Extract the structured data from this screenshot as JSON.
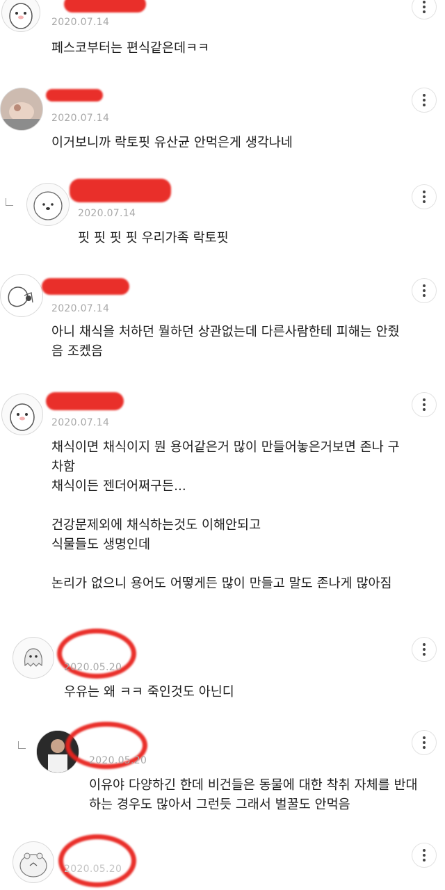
{
  "comments": [
    {
      "date": "2020.07.14",
      "text": "페스코부터는 편식같은데ㅋㅋ",
      "avatar": "penguin-avatar"
    },
    {
      "date": "2020.07.14",
      "text": "이거보니까 락토핏 유산균 안먹은게 생각나네",
      "avatar": "photo-avatar"
    },
    {
      "date": "2020.07.14",
      "text": "핏 핏 핏 핏 우리가족 락토핏",
      "avatar": "bear-avatar",
      "reply": true
    },
    {
      "date": "2020.07.14",
      "text": "아니 채식을 처하던 뭘하던 상관없는데 다른사람한테 피해는 안줬\n음 조켔음",
      "avatar": "drawing-avatar"
    },
    {
      "date": "2020.07.14",
      "text": "채식이면 채식이지 뭔 용어같은거 많이 만들어놓은거보면 존나 구\n차함\n채식이든 젠더어쩌구든...\n\n건강문제외에 채식하는것도 이해안되고\n식물들도 생명인데\n\n논리가 없으니 용어도 어떻게든 많이 만들고 말도 존나게 많아짐",
      "avatar": "penguin-avatar"
    },
    {
      "date": "2020.05.20",
      "text": "우유는 왜 ㅋㅋ 죽인것도 아닌디",
      "avatar": "ghost-avatar"
    },
    {
      "date": "2020.05.20",
      "text": "이유야 다양하긴 한데 비건들은 동물에 대한 착취 자체를 반대\n하는 경우도 많아서 그런듯 그래서 벌꿀도 안먹음",
      "avatar": "photo-avatar",
      "reply": true
    },
    {
      "date": "2020.05.20",
      "text": "",
      "avatar": "hippo-avatar"
    }
  ]
}
